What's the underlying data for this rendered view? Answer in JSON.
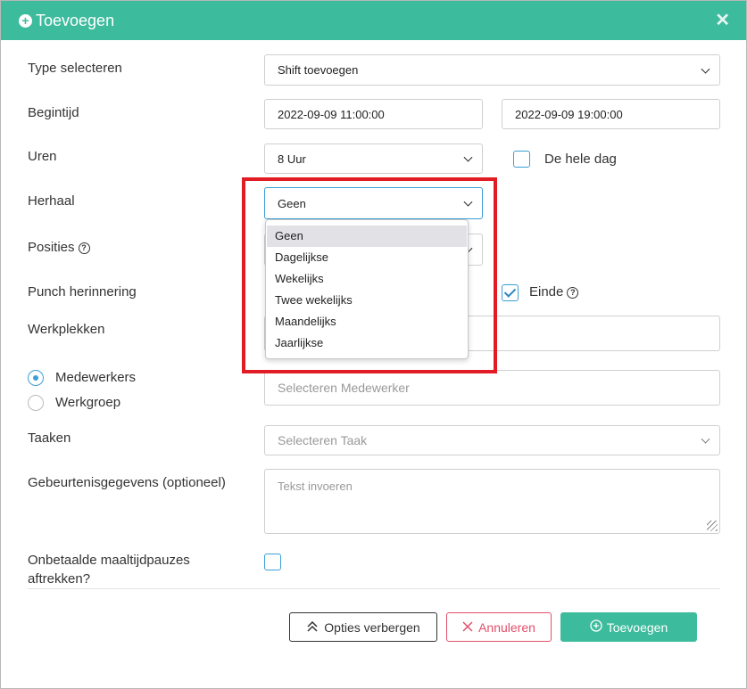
{
  "header": {
    "title": "Toevoegen",
    "plus_icon": "plus-circle-icon",
    "close_glyph": "✕",
    "accent": "#3dbb9d"
  },
  "form": {
    "type_label": "Type selecteren",
    "type_value": "Shift toevoegen",
    "begin_label": "Begintijd",
    "begin_start": "2022-09-09 11:00:00",
    "begin_end": "2022-09-09 19:00:00",
    "hours_label": "Uren",
    "hours_value": "8 Uur",
    "whole_day_label": "De hele dag",
    "repeat_label": "Herhaal",
    "repeat_value": "Geen",
    "positions_label": "Posities",
    "punch_label": "Punch herinnering",
    "end_label": "Einde",
    "workplaces_label": "Werkplekken",
    "employees_radio": "Medewerkers",
    "workgroup_radio": "Werkgroep",
    "employee_placeholder": "Selecteren Medewerker",
    "tasks_label": "Taaken",
    "tasks_placeholder": "Selecteren Taak",
    "event_label": "Gebeurtenisgegevens (optioneel)",
    "event_placeholder": "Tekst invoeren",
    "unpaid_label_1": "Onbetaalde maaltijdpauzes",
    "unpaid_label_2": "aftrekken?"
  },
  "repeat_options": [
    "Geen",
    "Dagelijkse",
    "Wekelijks",
    "Twee wekelijks",
    "Maandelijks",
    "Jaarlijkse"
  ],
  "buttons": {
    "hide_options": "Opties verbergen",
    "cancel": "Annuleren",
    "add": "Toevoegen"
  },
  "colors": {
    "highlight_box": "#e21c25",
    "cancel": "#e0506a",
    "checkbox": "#3b9fd6"
  }
}
